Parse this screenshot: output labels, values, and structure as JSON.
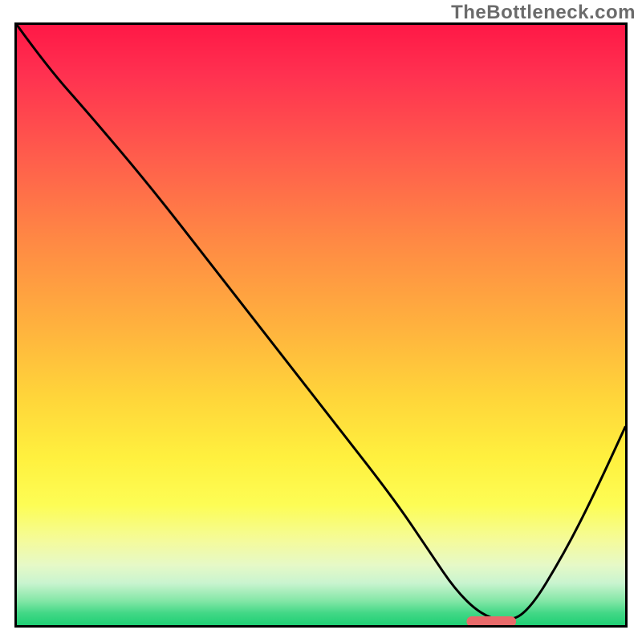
{
  "watermark": "TheBottleneck.com",
  "chart_data": {
    "type": "line",
    "title": "",
    "xlabel": "",
    "ylabel": "",
    "xlim": [
      0,
      100
    ],
    "ylim": [
      0,
      100
    ],
    "grid": false,
    "legend": false,
    "series": [
      {
        "name": "bottleneck-curve",
        "x": [
          0,
          5,
          12,
          22,
          32,
          42,
          52,
          62,
          68,
          72,
          76,
          80,
          84,
          90,
          95,
          100
        ],
        "y": [
          100,
          93,
          85,
          73,
          60,
          47,
          34,
          21,
          12,
          6,
          2,
          0.5,
          2,
          12,
          22,
          33
        ]
      }
    ],
    "marker": {
      "name": "optimal-range",
      "x_center": 78,
      "y": 0.6,
      "width": 8,
      "color": "#e86a6a"
    },
    "gradient_stops": [
      {
        "pos": 0,
        "color": "#ff1846"
      },
      {
        "pos": 50,
        "color": "#ffb13e"
      },
      {
        "pos": 80,
        "color": "#fdfd55"
      },
      {
        "pos": 100,
        "color": "#1fcf74"
      }
    ]
  }
}
